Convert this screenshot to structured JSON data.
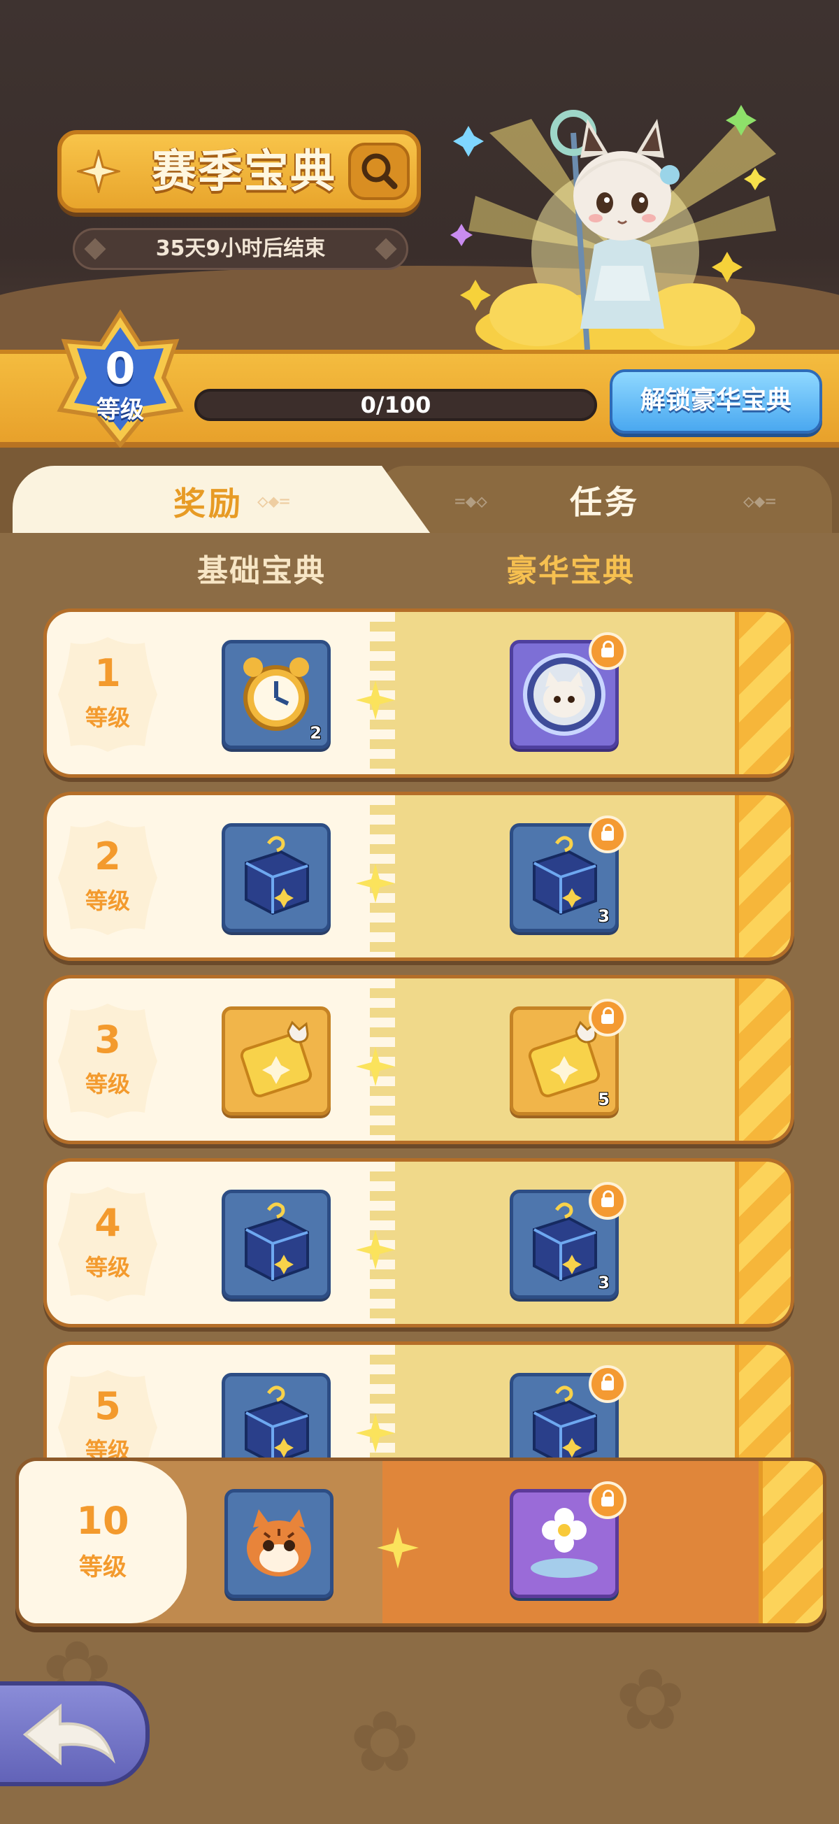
{
  "header": {
    "title": "赛季宝典",
    "countdown": "35天9小时后结束"
  },
  "level": {
    "current": "0",
    "label": "等级",
    "progress_text": "0/100",
    "progress_fraction": 0
  },
  "unlock_button": "解锁豪华宝典",
  "tabs": [
    {
      "label": "奖励",
      "active": true
    },
    {
      "label": "任务",
      "active": false
    }
  ],
  "columns": {
    "basic": "基础宝典",
    "deluxe": "豪华宝典"
  },
  "rows": [
    {
      "level": "1",
      "label": "等级",
      "basic": {
        "icon": "alarm-clock-icon",
        "count": "2"
      },
      "deluxe": {
        "icon": "cat-avatar-frame-icon",
        "count": "",
        "locked": true
      }
    },
    {
      "level": "2",
      "label": "等级",
      "basic": {
        "icon": "mystery-box-icon",
        "count": ""
      },
      "deluxe": {
        "icon": "mystery-box-icon",
        "count": "3",
        "locked": true
      }
    },
    {
      "level": "3",
      "label": "等级",
      "basic": {
        "icon": "golden-ticket-icon",
        "count": ""
      },
      "deluxe": {
        "icon": "golden-ticket-icon",
        "count": "5",
        "locked": true
      }
    },
    {
      "level": "4",
      "label": "等级",
      "basic": {
        "icon": "mystery-box-icon",
        "count": ""
      },
      "deluxe": {
        "icon": "mystery-box-icon",
        "count": "3",
        "locked": true
      }
    },
    {
      "level": "5",
      "label": "等级",
      "basic": {
        "icon": "mystery-box-icon",
        "count": ""
      },
      "deluxe": {
        "icon": "mystery-box-icon",
        "count": "",
        "locked": true
      }
    }
  ],
  "milestone": {
    "level": "10",
    "label": "等级",
    "basic": {
      "icon": "tiger-cat-icon"
    },
    "deluxe": {
      "icon": "flower-effect-icon",
      "locked": true
    }
  },
  "colors": {
    "accent_orange": "#f39a2d",
    "unlock_blue": "#4aa8f0",
    "level_badge_blue": "#3d6fd1"
  }
}
